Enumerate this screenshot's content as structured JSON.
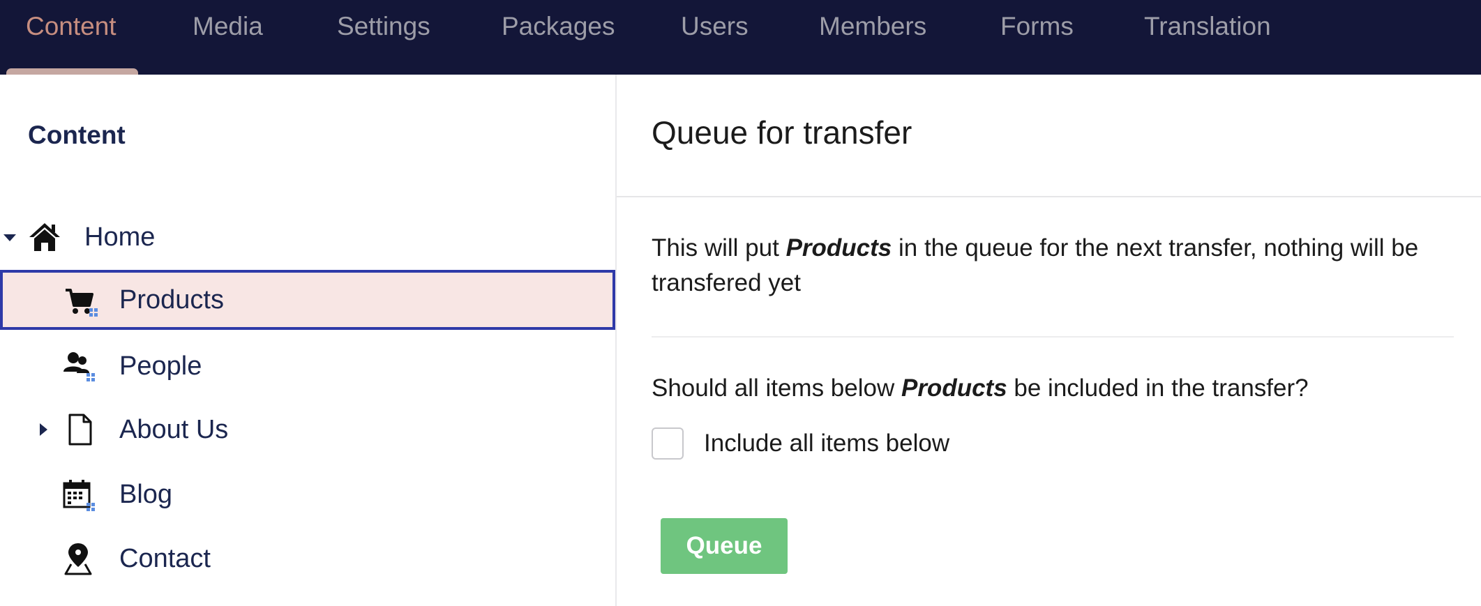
{
  "nav": {
    "items": [
      {
        "label": "Content"
      },
      {
        "label": "Media"
      },
      {
        "label": "Settings"
      },
      {
        "label": "Packages"
      },
      {
        "label": "Users"
      },
      {
        "label": "Members"
      },
      {
        "label": "Forms"
      },
      {
        "label": "Translation"
      }
    ]
  },
  "sidebar": {
    "title": "Content",
    "tree": [
      {
        "label": "Home",
        "icon": "home-icon"
      },
      {
        "label": "Products",
        "icon": "cart-icon"
      },
      {
        "label": "People",
        "icon": "people-icon"
      },
      {
        "label": "About Us",
        "icon": "document-icon"
      },
      {
        "label": "Blog",
        "icon": "calendar-icon"
      },
      {
        "label": "Contact",
        "icon": "map-pin-icon"
      }
    ]
  },
  "main": {
    "title": "Queue for transfer",
    "description": {
      "prefix": "This will put ",
      "item": "Products",
      "suffix": " in the queue for the next transfer, nothing will be transfered yet"
    },
    "question": {
      "prefix": "Should all items below ",
      "item": "Products",
      "suffix": " be included in the transfer?"
    },
    "checkbox_label": "Include all items below",
    "button_label": "Queue"
  },
  "colors": {
    "topbar": "#131638",
    "active_nav": "#e7a48d",
    "selected_bg": "#f8e6e4",
    "selected_border": "#2f3aa8",
    "button": "#6fc57f"
  }
}
